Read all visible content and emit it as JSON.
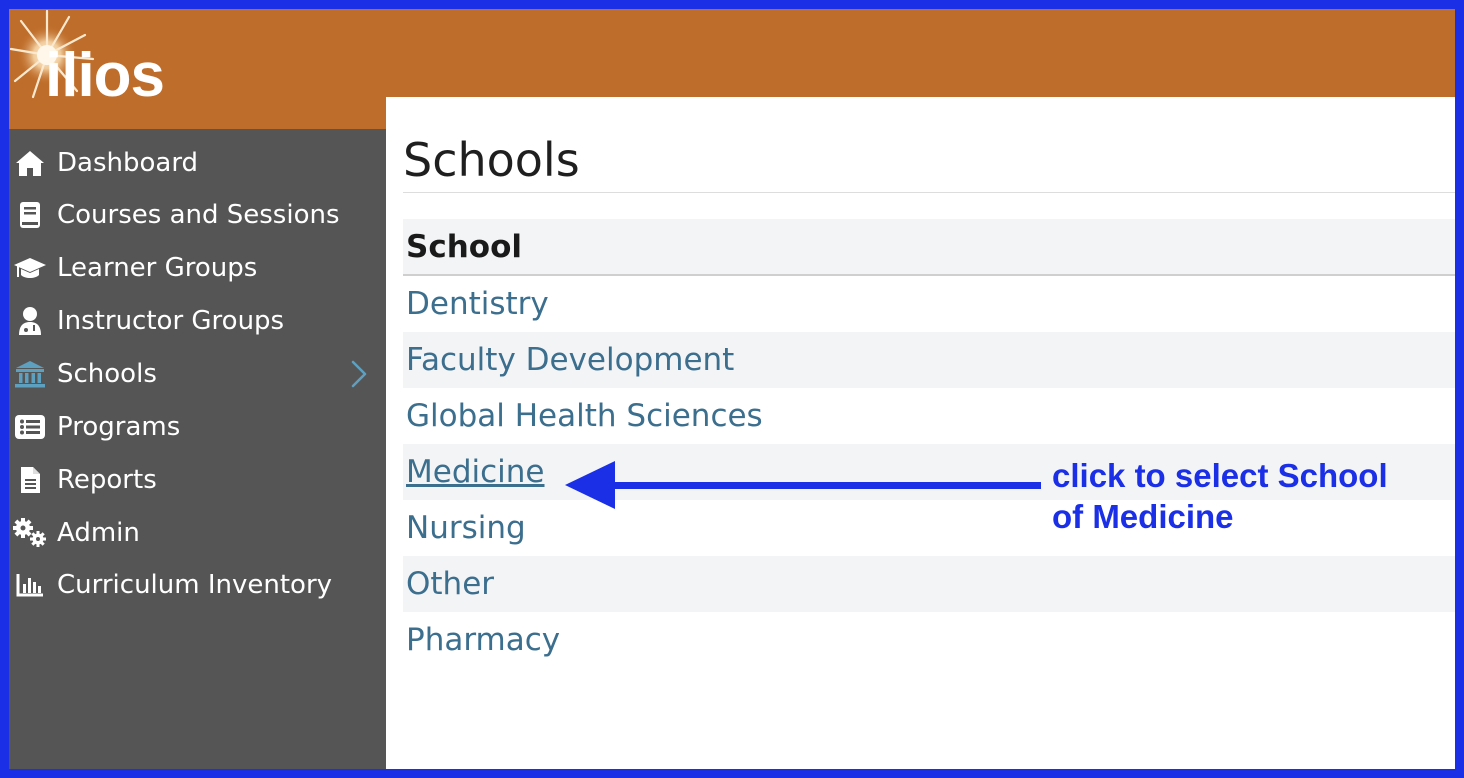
{
  "app": {
    "logo_text": "ilios"
  },
  "sidebar": {
    "items": [
      {
        "label": "Dashboard",
        "icon": "home-icon"
      },
      {
        "label": "Courses and Sessions",
        "icon": "book-icon"
      },
      {
        "label": "Learner Groups",
        "icon": "graduation-cap-icon"
      },
      {
        "label": "Instructor Groups",
        "icon": "user-doctor-icon"
      },
      {
        "label": "Schools",
        "icon": "university-icon",
        "active": true,
        "chevron": "chevron-right-icon"
      },
      {
        "label": "Programs",
        "icon": "list-icon"
      },
      {
        "label": "Reports",
        "icon": "file-icon"
      },
      {
        "label": "Admin",
        "icon": "gears-icon"
      },
      {
        "label": "Curriculum Inventory",
        "icon": "bar-chart-icon"
      }
    ]
  },
  "main": {
    "title": "Schools",
    "table": {
      "header": "School",
      "rows": [
        "Dentistry",
        "Faculty Development",
        "Global Health Sciences",
        "Medicine",
        "Nursing",
        "Other",
        "Pharmacy"
      ]
    }
  },
  "annotation": {
    "line1": "click to select School",
    "line2": "of Medicine"
  },
  "colors": {
    "brand_orange": "#bf6d2a",
    "sidebar_bg": "#555555",
    "link": "#3c6e8e",
    "active_icon": "#5ea0c0",
    "annotation_blue": "#1a2fe6"
  }
}
